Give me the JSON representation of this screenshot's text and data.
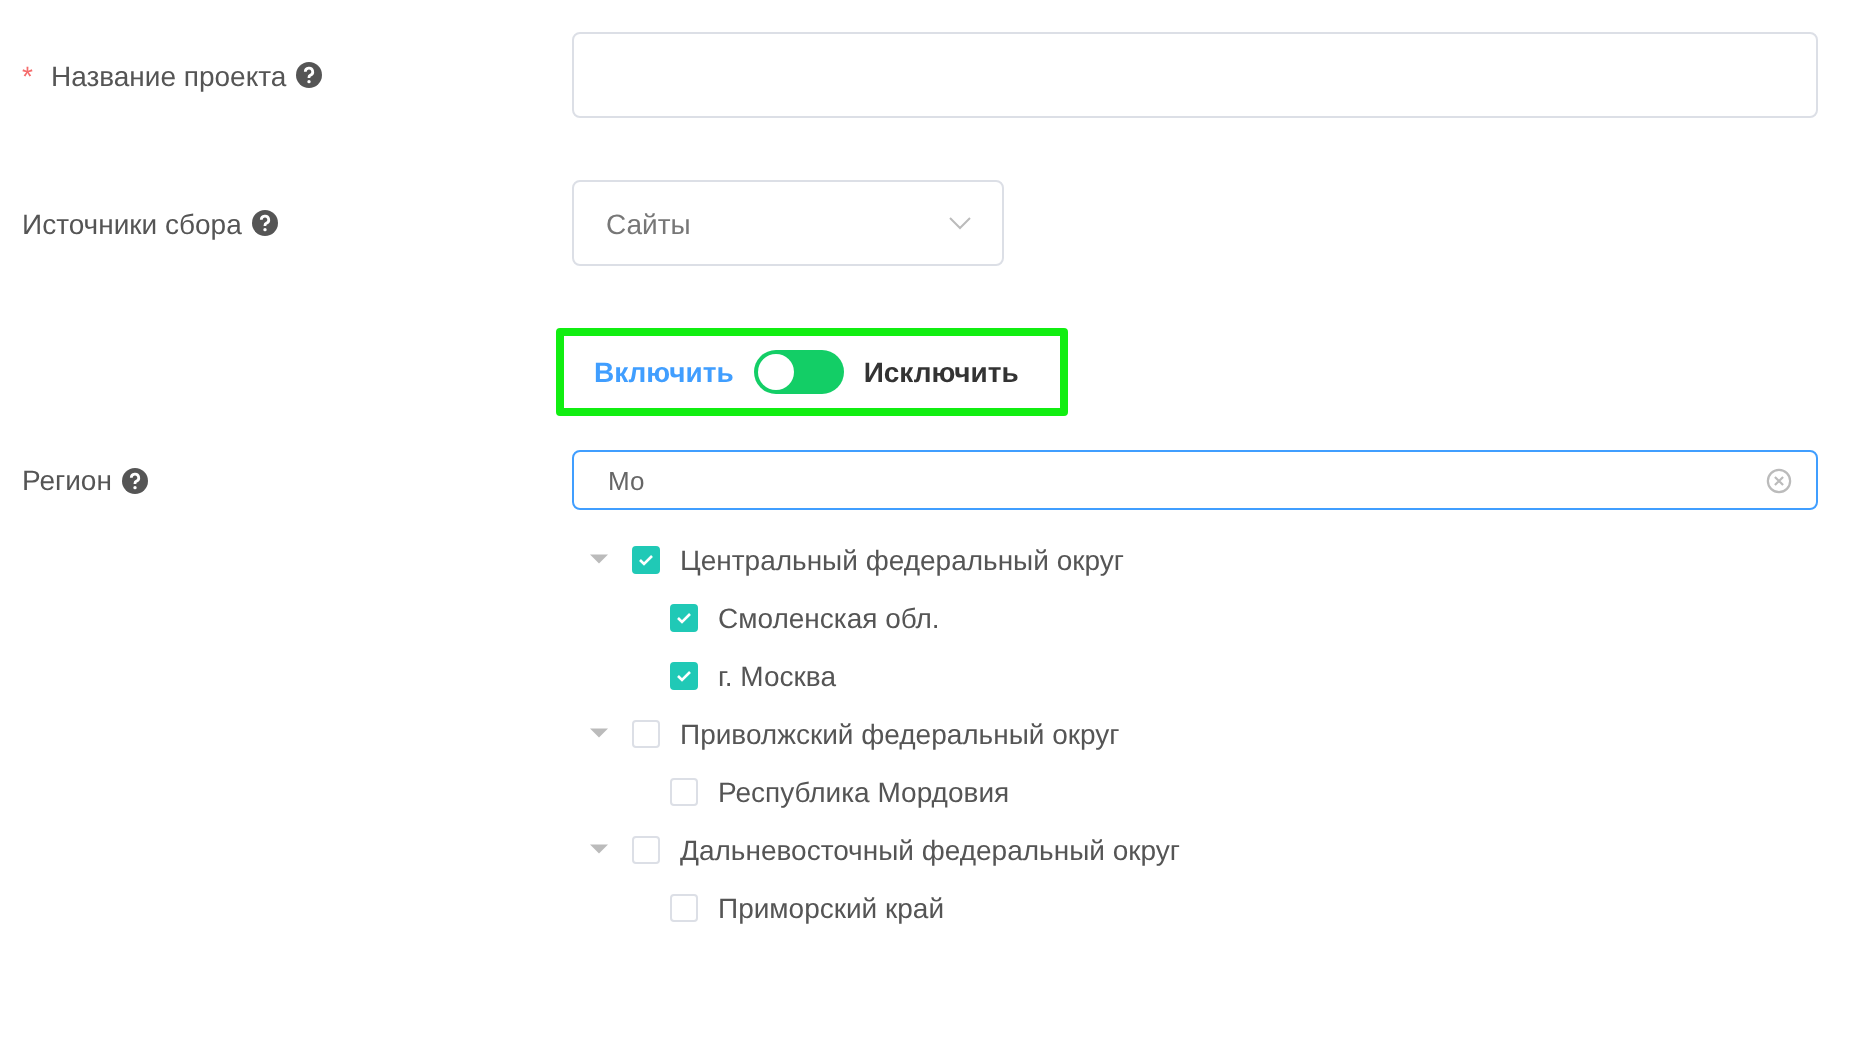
{
  "fields": [
    {
      "kind": "text",
      "label": "Название проекта",
      "required_mark": "*",
      "help": true
    },
    {
      "kind": "select",
      "label": "Источники сбора",
      "help": true,
      "value": "Сайты"
    }
  ],
  "mode_toggle": {
    "options": [
      {
        "label": "Включить",
        "selected": true
      },
      {
        "label": "Исключить",
        "selected": false
      }
    ]
  },
  "region": {
    "label": "Регион",
    "help": true,
    "value": "Мо",
    "tree": [
      {
        "label": "Центральный федеральный округ",
        "checked": true,
        "expanded": true,
        "children": [
          {
            "label": "Смоленская обл.",
            "checked": true
          },
          {
            "label": "г. Москва",
            "checked": true
          }
        ]
      },
      {
        "label": "Приволжский федеральный округ",
        "checked": false,
        "expanded": true,
        "children": [
          {
            "label": "Республика Мордовия",
            "checked": false
          }
        ]
      },
      {
        "label": "Дальневосточный федеральный округ",
        "checked": false,
        "expanded": true,
        "children": [
          {
            "label": "Приморский край",
            "checked": false
          }
        ]
      }
    ]
  }
}
